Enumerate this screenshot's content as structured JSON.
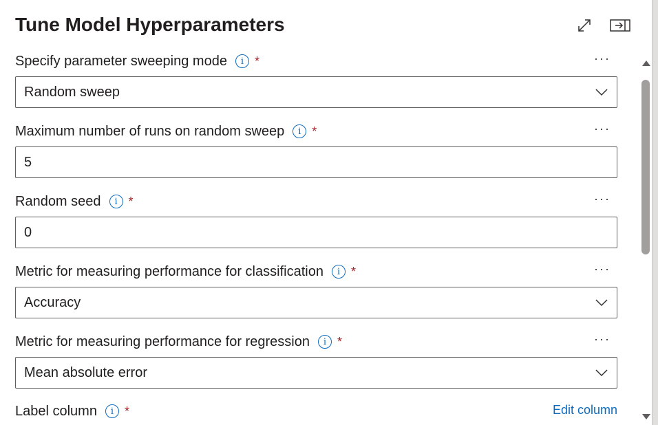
{
  "panel": {
    "title": "Tune Model Hyperparameters",
    "icons": {
      "expand": "expand-icon",
      "collapse": "dock-right-icon"
    }
  },
  "fields": [
    {
      "label": "Specify parameter sweeping mode",
      "required": "*",
      "more": "···",
      "type": "dropdown",
      "value": "Random sweep"
    },
    {
      "label": "Maximum number of runs on random sweep",
      "required": "*",
      "more": "···",
      "type": "text",
      "value": "5"
    },
    {
      "label": "Random seed",
      "required": "*",
      "more": "···",
      "type": "text",
      "value": "0"
    },
    {
      "label": "Metric for measuring performance for classification",
      "required": "*",
      "more": "···",
      "type": "dropdown",
      "value": "Accuracy"
    },
    {
      "label": "Metric for measuring performance for regression",
      "required": "*",
      "more": "···",
      "type": "dropdown",
      "value": "Mean absolute error"
    },
    {
      "label": "Label column",
      "required": "*",
      "link": "Edit column"
    }
  ],
  "colors": {
    "accent": "#0f6cbd",
    "required": "#a4262c",
    "border": "#605e5c"
  }
}
